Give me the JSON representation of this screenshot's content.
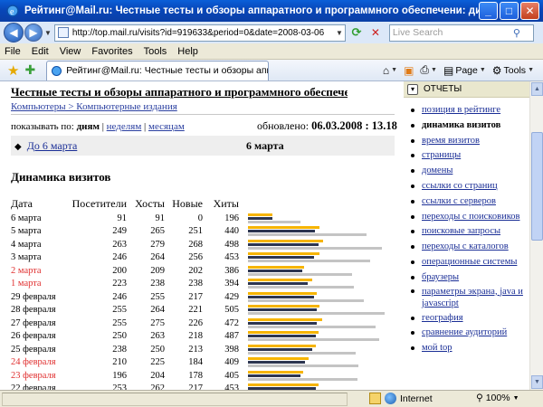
{
  "window": {
    "title": "Рейтинг@Mail.ru: Честные тесты и обзоры аппаратного и программного обеспечени: динамика визитов - ...",
    "minimize": "_",
    "maximize": "□",
    "close": "✕"
  },
  "address": {
    "url": "http://top.mail.ru/visits?id=919633&period=0&date=2008-03-06",
    "search_placeholder": "Live Search"
  },
  "menu": [
    "File",
    "Edit",
    "View",
    "Favorites",
    "Tools",
    "Help"
  ],
  "tab": {
    "label": "Рейтинг@Mail.ru: Честные тесты и обзоры аппарат..."
  },
  "commands": {
    "page": "Page",
    "tools": "Tools"
  },
  "site": {
    "heading": "Честные тесты и обзоры аппаратного и программного обеспечени",
    "category": "Компьютеры > Компьютерные издания"
  },
  "period": {
    "prefix": "показывать по:",
    "current": "дням",
    "weeks": "неделям",
    "months": "месяцам",
    "sep": "|"
  },
  "updated": {
    "label": "обновлено:",
    "value": "06.03.2008 : 13.18"
  },
  "nav": {
    "arrow": "◆",
    "prev": "До 6 марта",
    "current": "6 марта"
  },
  "section_title": "Динамика визитов",
  "table": {
    "headers": [
      "Дата",
      "Посетители",
      "Хосты",
      "Новые",
      "Хиты"
    ],
    "rows": [
      {
        "date": "6 марта",
        "visitors": 91,
        "hosts": 91,
        "new": 0,
        "hits": 196,
        "weekend": false
      },
      {
        "date": "5 марта",
        "visitors": 249,
        "hosts": 265,
        "new": 251,
        "hits": 440,
        "weekend": false
      },
      {
        "date": "4 марта",
        "visitors": 263,
        "hosts": 279,
        "new": 268,
        "hits": 498,
        "weekend": false
      },
      {
        "date": "3 марта",
        "visitors": 246,
        "hosts": 264,
        "new": 256,
        "hits": 453,
        "weekend": false
      },
      {
        "date": "2 марта",
        "visitors": 200,
        "hosts": 209,
        "new": 202,
        "hits": 386,
        "weekend": true
      },
      {
        "date": "1 марта",
        "visitors": 223,
        "hosts": 238,
        "new": 238,
        "hits": 394,
        "weekend": true
      },
      {
        "date": "29 февраля",
        "visitors": 246,
        "hosts": 255,
        "new": 217,
        "hits": 429,
        "weekend": false
      },
      {
        "date": "28 февраля",
        "visitors": 255,
        "hosts": 264,
        "new": 221,
        "hits": 505,
        "weekend": false
      },
      {
        "date": "27 февраля",
        "visitors": 255,
        "hosts": 275,
        "new": 226,
        "hits": 472,
        "weekend": false
      },
      {
        "date": "26 февраля",
        "visitors": 250,
        "hosts": 263,
        "new": 218,
        "hits": 487,
        "weekend": false
      },
      {
        "date": "25 февраля",
        "visitors": 238,
        "hosts": 250,
        "new": 213,
        "hits": 398,
        "weekend": false
      },
      {
        "date": "24 февраля",
        "visitors": 210,
        "hosts": 225,
        "new": 184,
        "hits": 409,
        "weekend": true
      },
      {
        "date": "23 февраля",
        "visitors": 196,
        "hosts": 204,
        "new": 178,
        "hits": 405,
        "weekend": true
      },
      {
        "date": "22 февраля",
        "visitors": 253,
        "hosts": 262,
        "new": 217,
        "hits": 453,
        "weekend": false
      }
    ]
  },
  "right_menu": {
    "header": "ОТЧЕТЫ",
    "items": [
      {
        "label": "позиция в рейтинге",
        "active": false
      },
      {
        "label": "динамика визитов",
        "active": true
      },
      {
        "label": "время визитов",
        "active": false
      },
      {
        "label": "страницы",
        "active": false
      },
      {
        "label": "домены",
        "active": false
      },
      {
        "label": "ссылки со страниц",
        "active": false
      },
      {
        "label": "ссылки с серверов",
        "active": false
      },
      {
        "label": "переходы с поисковиков",
        "active": false
      },
      {
        "label": "поисковые запросы",
        "active": false
      },
      {
        "label": "переходы с каталогов",
        "active": false
      },
      {
        "label": "операционные системы",
        "active": false
      },
      {
        "label": "браузеры",
        "active": false
      },
      {
        "label": "параметры экрана, java и javascript",
        "active": false
      },
      {
        "label": "география",
        "active": false
      },
      {
        "label": "сравнение аудиторий",
        "active": false
      },
      {
        "label": "мой top",
        "active": false
      }
    ]
  },
  "status": {
    "zone": "Internet",
    "zoom": "100%"
  },
  "colors": {
    "bar_hosts": "#f6b400",
    "bar_visitors": "#2c3550",
    "bar_hits": "#c4c4c4",
    "weekend": "#e03030",
    "link": "#1a2e96"
  }
}
